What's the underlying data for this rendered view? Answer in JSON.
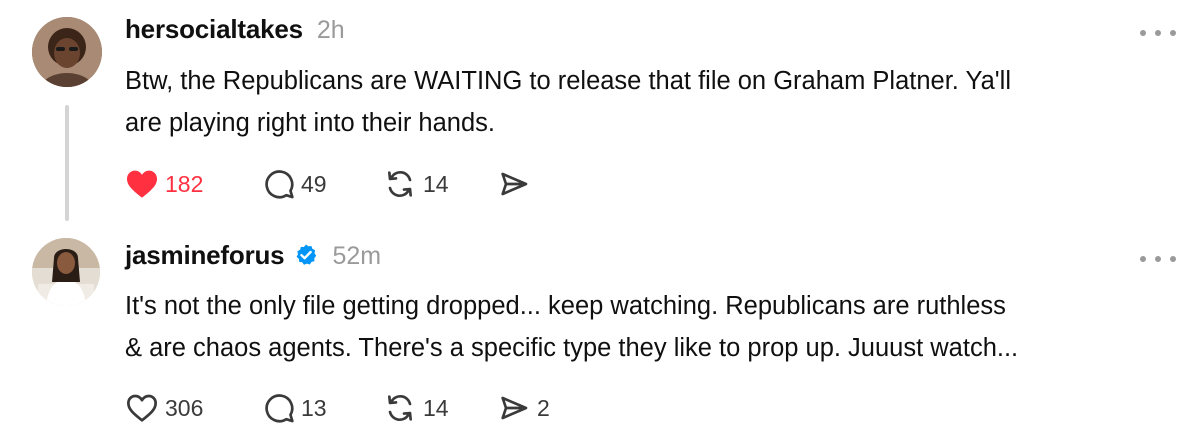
{
  "posts": [
    {
      "username": "hersocialtakes",
      "time": "2h",
      "verified": false,
      "text": "Btw, the Republicans are WAITING to release that file on Graham Platner. Ya'll\nare playing right into their hands.",
      "likes": "182",
      "liked": true,
      "replies": "49",
      "reposts": "14",
      "shares": ""
    },
    {
      "username": "jasmineforus",
      "time": "52m",
      "verified": true,
      "text": "It's not the only file getting dropped... keep watching. Republicans are ruthless\n& are chaos agents. There's a specific type they like to prop up. Juuust watch...",
      "likes": "306",
      "liked": false,
      "replies": "13",
      "reposts": "14",
      "shares": "2"
    }
  ],
  "icons": {
    "like": "heart-icon",
    "reply": "comment-icon",
    "repost": "repost-icon",
    "share": "share-icon",
    "more": "more-icon",
    "verified": "verified-badge-icon"
  },
  "colors": {
    "liked": "#ff3040",
    "verified": "#0095f6",
    "muted": "#9a9a9a"
  }
}
